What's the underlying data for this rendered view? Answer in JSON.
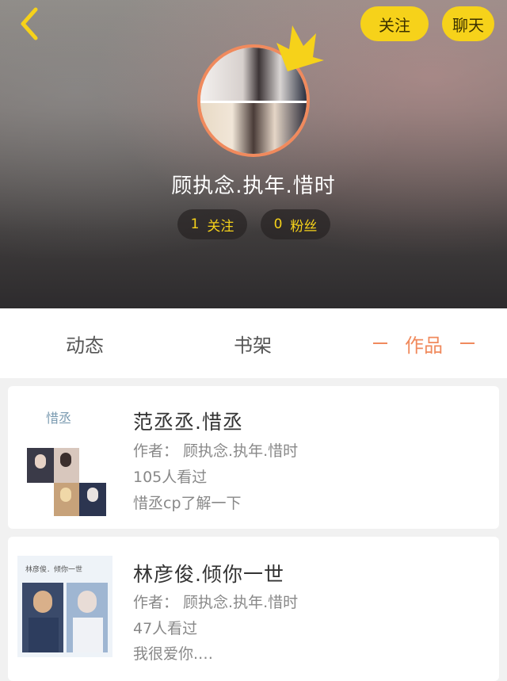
{
  "header": {
    "follow_label": "关注",
    "chat_label": "聊天",
    "username": "顾执念.执年.惜时",
    "following_count": "1",
    "following_label": "关注",
    "fans_count": "0",
    "fans_label": "粉丝"
  },
  "tabs": [
    {
      "label": "动态",
      "active": false
    },
    {
      "label": "书架",
      "active": false
    },
    {
      "label": "作品",
      "active": true
    }
  ],
  "works": [
    {
      "cover_title": "惜丞",
      "title": "范丞丞.惜丞",
      "author": "作者：  顾执念.执年.惜时",
      "views": "105人看过",
      "description": "惜丞cp了解一下"
    },
    {
      "cover_title": "林彦俊．倾你一世",
      "title": "林彦俊.倾你一世",
      "author": "作者：  顾执念.执年.惜时",
      "views": "47人看过",
      "description": "我很爱你.…"
    }
  ],
  "colors": {
    "accent_yellow": "#f6d21a",
    "accent_orange": "#f08a5d"
  }
}
